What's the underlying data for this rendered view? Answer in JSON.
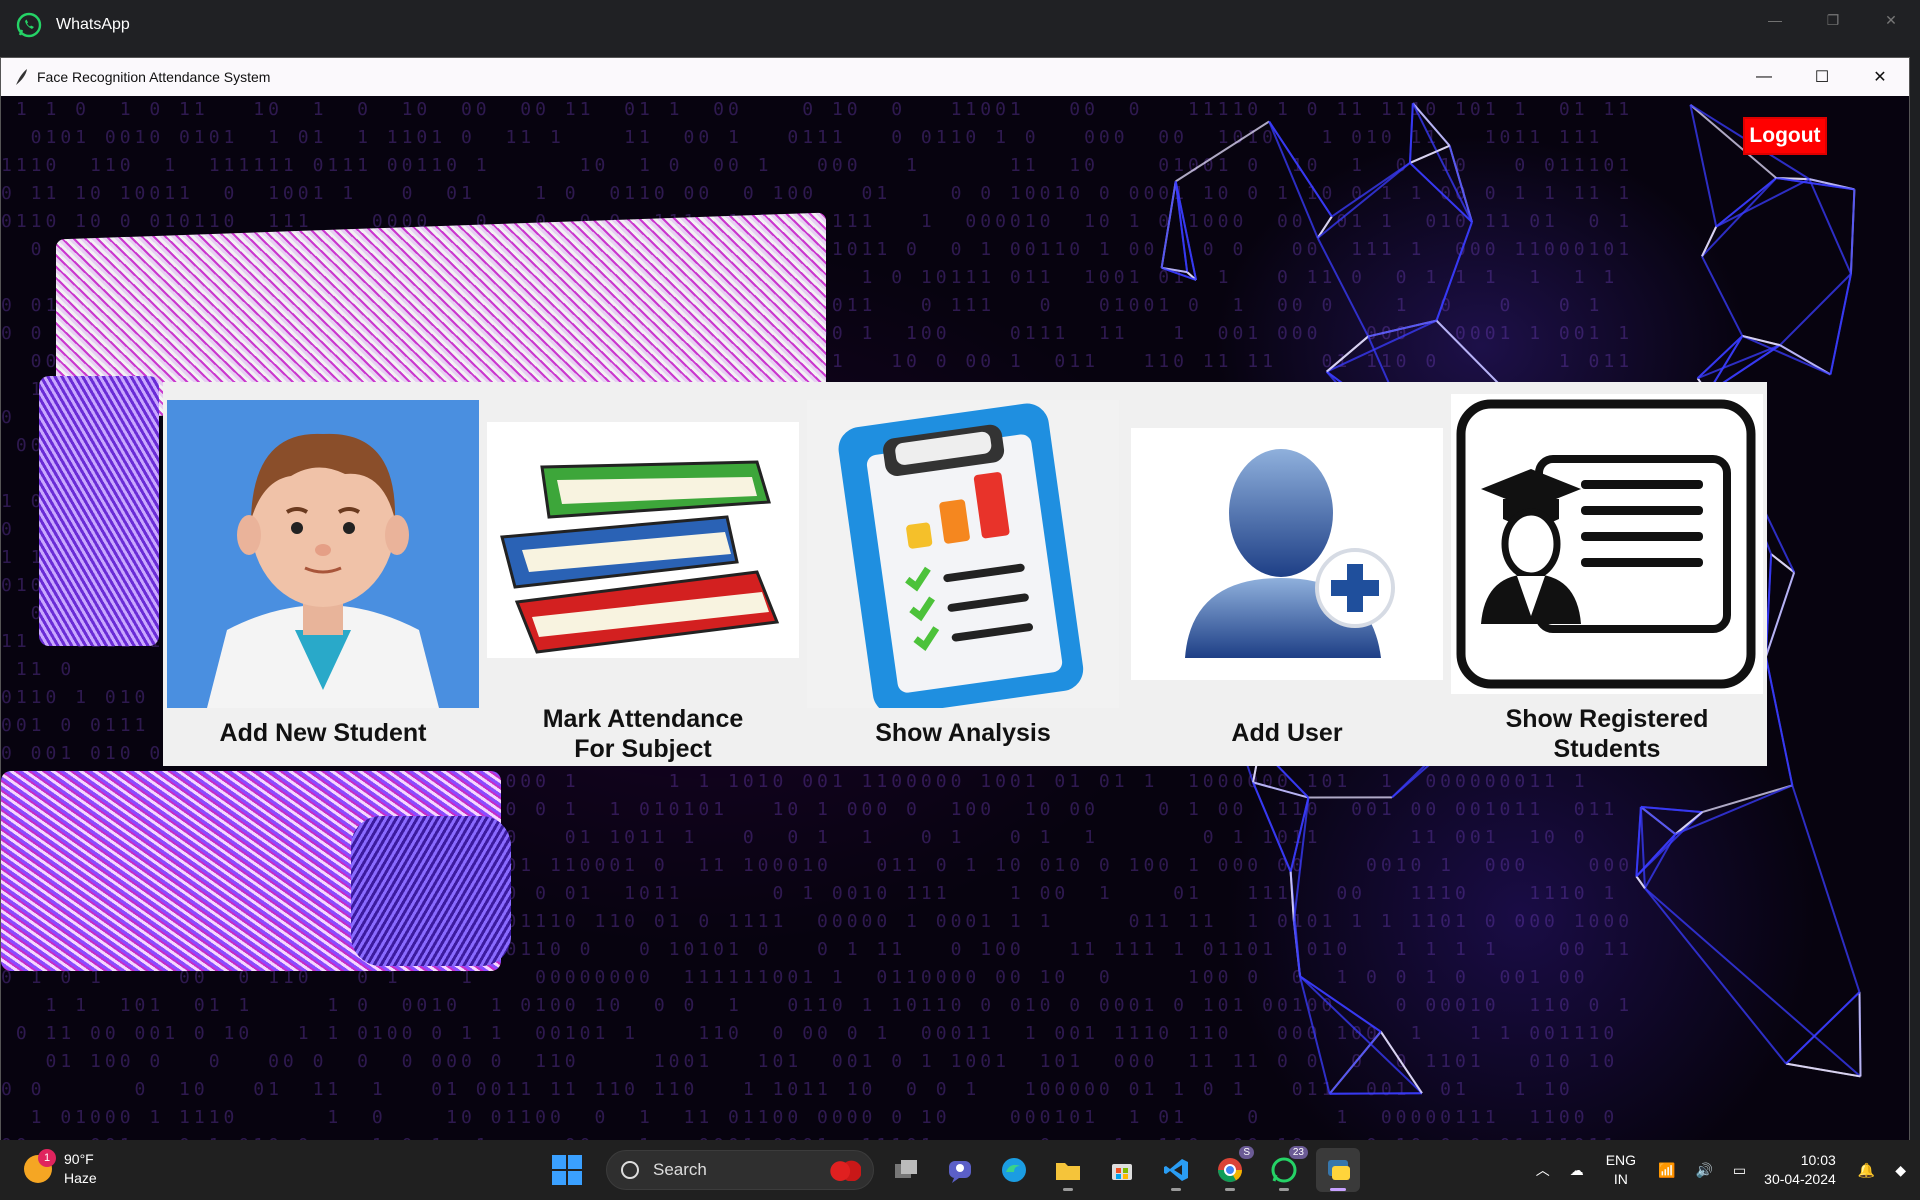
{
  "background_window": {
    "title": "WhatsApp",
    "controls": [
      "—",
      "❐",
      "✕"
    ]
  },
  "app": {
    "title": "Face Recognition Attendance System",
    "controls": [
      "—",
      "☐",
      "✕"
    ],
    "logout_label": "Logout",
    "tiles": [
      {
        "label": "Add New Student",
        "icon": "student-avatar-icon"
      },
      {
        "label": "Mark Attendance\nFor Subject",
        "icon": "books-stack-icon"
      },
      {
        "label": "Show Analysis",
        "icon": "clipboard-chart-icon"
      },
      {
        "label": "Add User",
        "icon": "add-user-icon"
      },
      {
        "label": "Show Registered\nStudents",
        "icon": "graduate-id-card-icon"
      }
    ],
    "accent_colors": {
      "logout": "#ff0000",
      "panel": "#f0f0f0"
    }
  },
  "taskbar": {
    "weather": {
      "badge": "1",
      "temp": "90°F",
      "condition": "Haze"
    },
    "search_placeholder": "Search",
    "whatsapp_badge": "23",
    "chrome_badge": "S",
    "lang_line1": "ENG",
    "lang_line2": "IN",
    "time": "10:03",
    "date": "30-04-2024"
  }
}
